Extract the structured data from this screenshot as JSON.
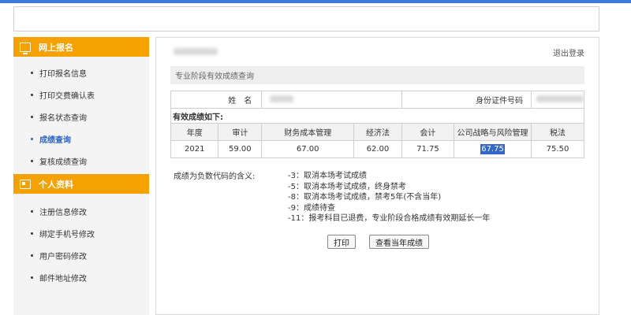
{
  "sidebar": {
    "section1": {
      "title": "网上报名",
      "icon": "monitor-icon"
    },
    "items1": [
      "打印报名信息",
      "打印交费确认表",
      "报名状态查询",
      "成绩查询",
      "复核成绩查询"
    ],
    "active_item": "成绩查询",
    "section2": {
      "title": "个人资料",
      "icon": "id-card-icon"
    },
    "items2": [
      "注册信息修改",
      "绑定手机号修改",
      "用户密码修改",
      "邮件地址修改"
    ]
  },
  "main": {
    "logout": "退出登录",
    "panel_title": "专业阶段有效成绩查询",
    "name_label": "姓　名",
    "id_label": "身份证件号码",
    "valid_title": "有效成绩如下:",
    "headers": [
      "年度",
      "审计",
      "财务成本管理",
      "经济法",
      "会计",
      "公司战略与风险管理",
      "税法"
    ],
    "row": [
      "2021",
      "59.00",
      "67.00",
      "62.00",
      "71.75",
      "67.75",
      "75.50"
    ],
    "legend_label": "成绩为负数代码的含义:",
    "codes": [
      "-3：取消本场考试成绩",
      "-5：取消本场考试成绩，终身禁考",
      "-8：取消本场考试成绩，禁考5年(不含当年)",
      "-9：成绩待查",
      "-11：报考科目已退费，专业阶段合格成绩有效期延长一年"
    ],
    "print_button": "打印",
    "year_button": "查看当年成绩"
  }
}
